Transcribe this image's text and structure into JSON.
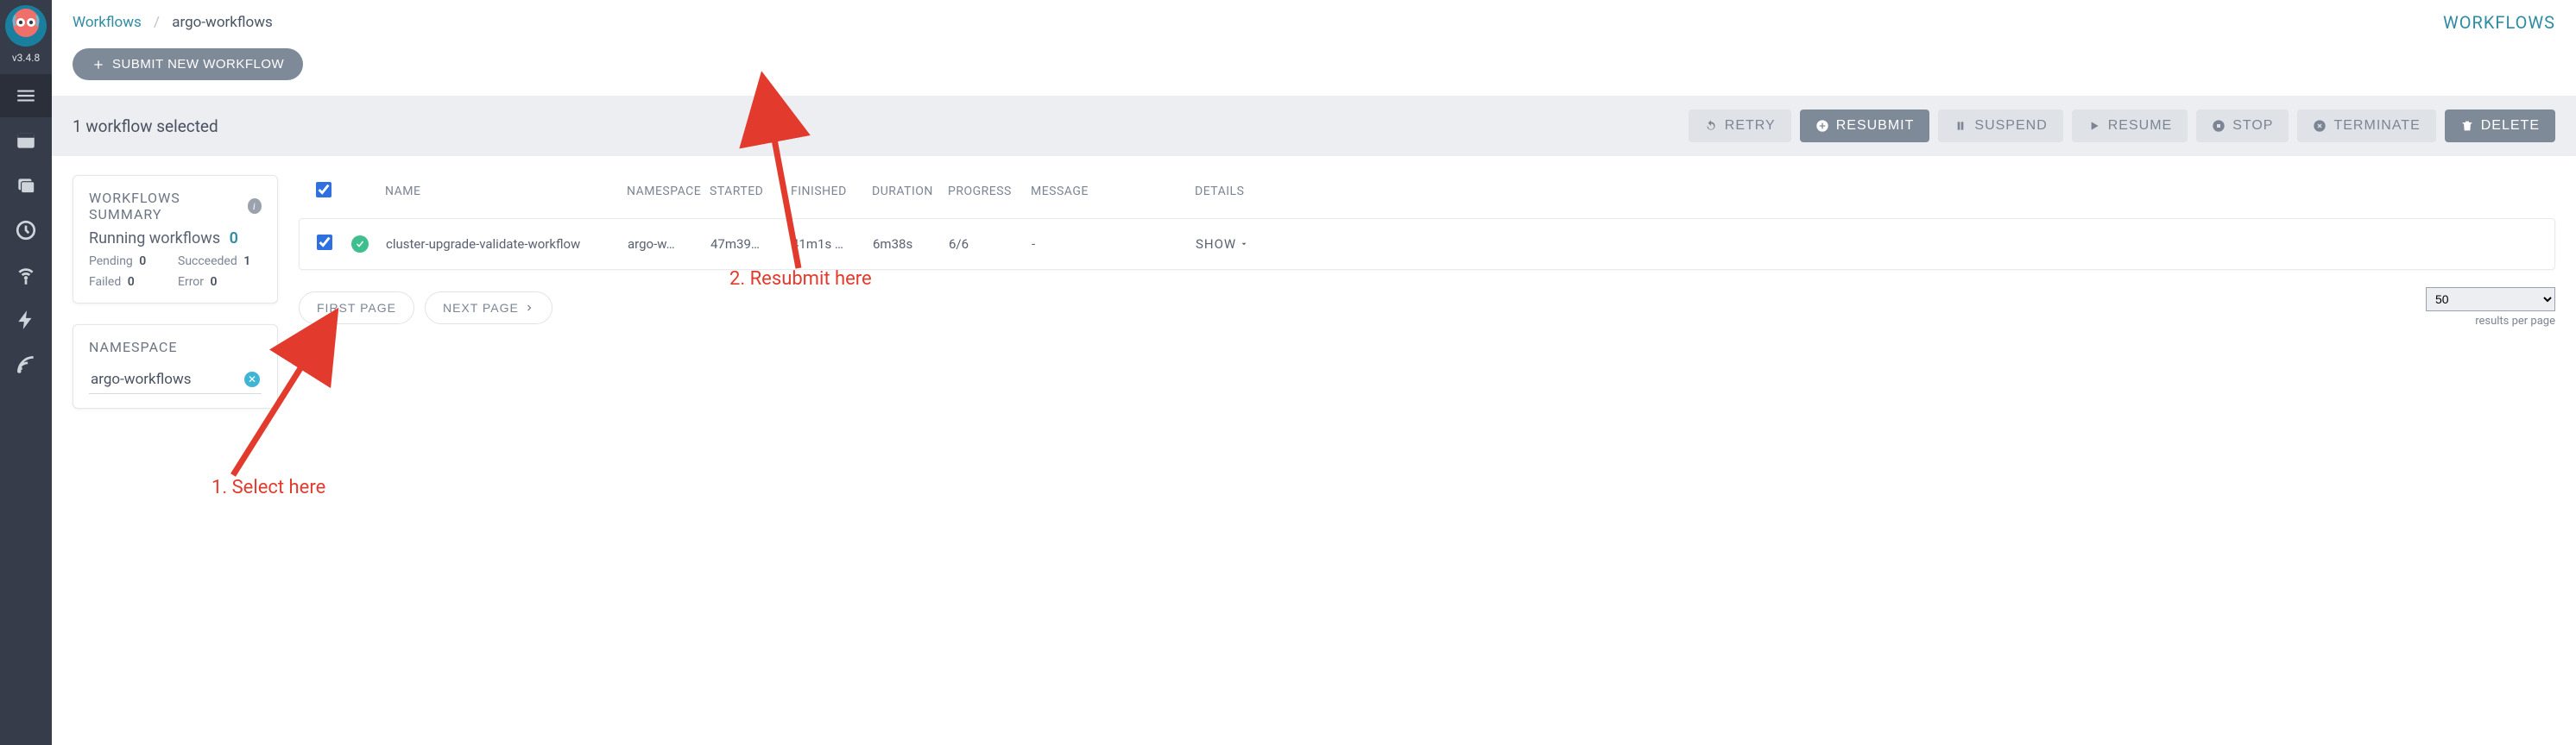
{
  "version": "v3.4.8",
  "breadcrumb": {
    "root": "Workflows",
    "current": "argo-workflows"
  },
  "page_title": "WORKFLOWS",
  "submit_button": "SUBMIT NEW WORKFLOW",
  "selection_text": "1 workflow selected",
  "toolbar": {
    "retry": "RETRY",
    "resubmit": "RESUBMIT",
    "suspend": "SUSPEND",
    "resume": "RESUME",
    "stop": "STOP",
    "terminate": "TERMINATE",
    "delete": "DELETE"
  },
  "summary": {
    "title": "WORKFLOWS SUMMARY",
    "running_label": "Running workflows",
    "running_count": "0",
    "pending_label": "Pending",
    "pending_count": "0",
    "succeeded_label": "Succeeded",
    "succeeded_count": "1",
    "failed_label": "Failed",
    "failed_count": "0",
    "error_label": "Error",
    "error_count": "0"
  },
  "namespace": {
    "title": "NAMESPACE",
    "value": "argo-workflows"
  },
  "columns": {
    "name": "NAME",
    "namespace": "NAMESPACE",
    "started": "STARTED",
    "finished": "FINISHED",
    "duration": "DURATION",
    "progress": "PROGRESS",
    "message": "MESSAGE",
    "details": "DETAILS"
  },
  "rows": [
    {
      "name": "cluster-upgrade-validate-workflow",
      "namespace": "argo-w…",
      "started": "47m39…",
      "finished": "41m1s …",
      "duration": "6m38s",
      "progress": "6/6",
      "message": "-",
      "details": "SHOW"
    }
  ],
  "pager": {
    "first": "FIRST PAGE",
    "next": "NEXT PAGE",
    "per_page_value": "50",
    "per_page_label": "results per page"
  },
  "annotations": {
    "select": "1. Select here",
    "resubmit": "2. Resubmit here"
  }
}
